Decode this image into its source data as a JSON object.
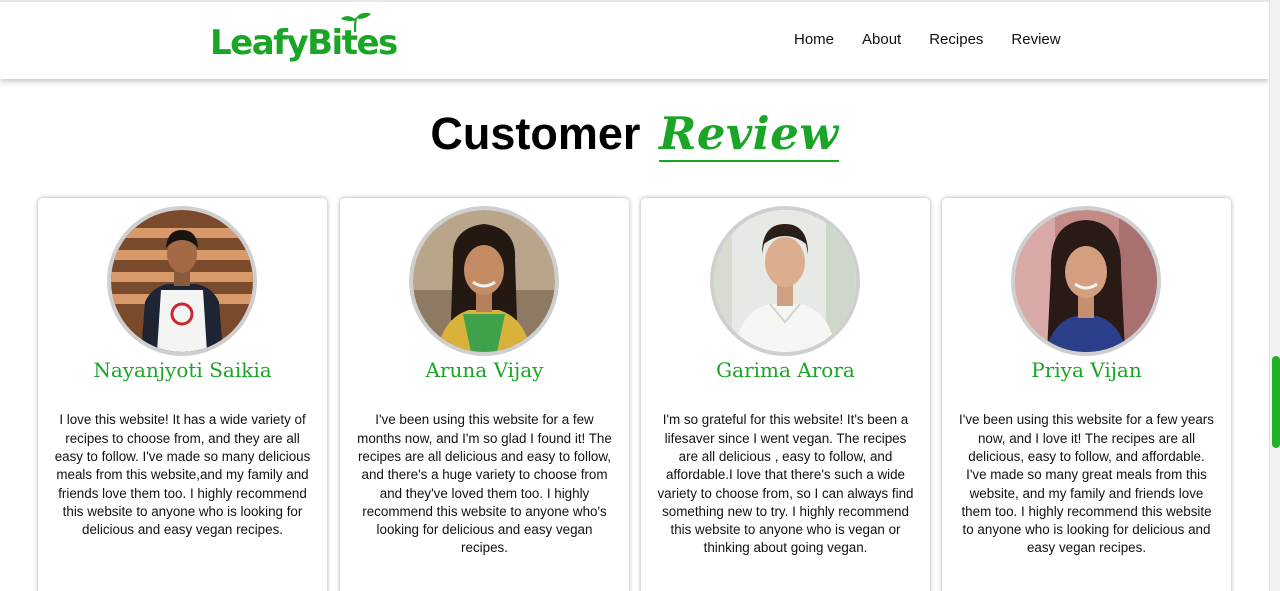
{
  "header": {
    "logo_text": "LeafyBites",
    "nav": [
      {
        "label": "Home"
      },
      {
        "label": "About"
      },
      {
        "label": "Recipes"
      },
      {
        "label": "Review"
      }
    ]
  },
  "section": {
    "title_main": "Customer",
    "title_accent": "Review"
  },
  "reviews": [
    {
      "name": "Nayanjyoti Saikia",
      "text": "I love this website! It has a wide variety of recipes to choose from, and they are all easy to follow. I've made so many delicious meals from this website,and my family and friends love them too. I highly recommend this website to anyone who is looking for delicious and easy vegan recipes."
    },
    {
      "name": "Aruna Vijay",
      "text": "I've been using this website for a few months now, and I'm so glad I found it! The recipes are all delicious and easy to follow, and there's a huge variety to choose from and they've loved them too. I highly recommend this website to anyone who's looking for delicious and easy vegan recipes."
    },
    {
      "name": "Garima Arora",
      "text": "I'm so grateful for this website! It's been a lifesaver since I went vegan. The recipes are all delicious , easy to follow, and affordable.I love that there's such a wide variety to choose from, so I can always find something new to try. I highly recommend this website to anyone who is vegan or thinking about going vegan."
    },
    {
      "name": "Priya Vijan",
      "text": "I've been using this website for a few years now, and I love it! The recipes are all delicious, easy to follow, and affordable. I've made so many great meals from this website, and my family and friends love them too. I highly recommend this website to anyone who is looking for delicious and easy vegan recipes."
    }
  ],
  "theme": {
    "brand_green": "#1aa526",
    "scrollbar_thumb": "#1fb224"
  }
}
